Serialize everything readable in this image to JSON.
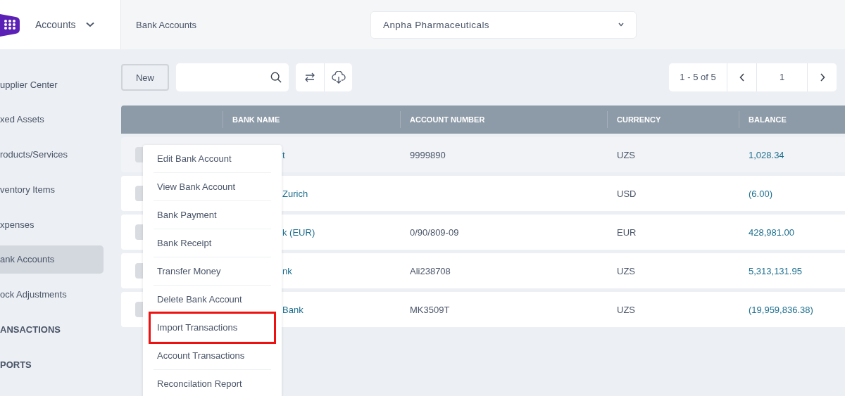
{
  "app_menu": {
    "label": "Accounts"
  },
  "breadcrumb": "Bank Accounts",
  "company": {
    "value": "Anpha Pharmaceuticals"
  },
  "sidebar": {
    "items": [
      {
        "label": "upplier Center",
        "kind": "link",
        "selected": false
      },
      {
        "label": "xed Assets",
        "kind": "link",
        "selected": false
      },
      {
        "label": "roducts/Services",
        "kind": "link",
        "selected": false
      },
      {
        "label": "ventory Items",
        "kind": "link",
        "selected": false
      },
      {
        "label": "xpenses",
        "kind": "link",
        "selected": false
      },
      {
        "label": "ank Accounts",
        "kind": "link",
        "selected": true
      },
      {
        "label": "ock Adjustments",
        "kind": "link",
        "selected": false
      },
      {
        "label": "ANSACTIONS",
        "kind": "section",
        "selected": false
      },
      {
        "label": "PORTS",
        "kind": "section",
        "selected": false
      }
    ]
  },
  "toolbar": {
    "new_button": "New"
  },
  "pagination": {
    "range": "1 - 5 of 5",
    "page": "1"
  },
  "table": {
    "columns": [
      "BANK NAME",
      "ACCOUNT NUMBER",
      "CURRENCY",
      "BALANCE"
    ],
    "rows": [
      {
        "bank_name": "t",
        "account_number": "9999890",
        "currency": "UZS",
        "balance": "1,028.34",
        "selected": true
      },
      {
        "bank_name": "Zurich",
        "account_number": "",
        "currency": "USD",
        "balance": "(6.00)",
        "selected": false
      },
      {
        "bank_name": "k (EUR)",
        "account_number": "0/90/809-09",
        "currency": "EUR",
        "balance": "428,981.00",
        "selected": false
      },
      {
        "bank_name": "nk",
        "account_number": "Ali238708",
        "currency": "UZS",
        "balance": "5,313,131.95",
        "selected": false
      },
      {
        "bank_name": "Bank",
        "account_number": "MK3509T",
        "currency": "UZS",
        "balance": "(19,959,836.38)",
        "selected": false
      }
    ]
  },
  "context_menu": {
    "items": [
      {
        "label": "Edit Bank Account",
        "highlighted": false
      },
      {
        "label": "View Bank Account",
        "highlighted": false
      },
      {
        "label": "Bank Payment",
        "highlighted": false
      },
      {
        "label": "Bank Receipt",
        "highlighted": false
      },
      {
        "label": "Transfer Money",
        "highlighted": false
      },
      {
        "label": "Delete Bank Account",
        "highlighted": false
      },
      {
        "label": "Import Transactions",
        "highlighted": true
      },
      {
        "label": "Account Transactions",
        "highlighted": false
      },
      {
        "label": "Reconcilation Report",
        "highlighted": false
      }
    ]
  }
}
